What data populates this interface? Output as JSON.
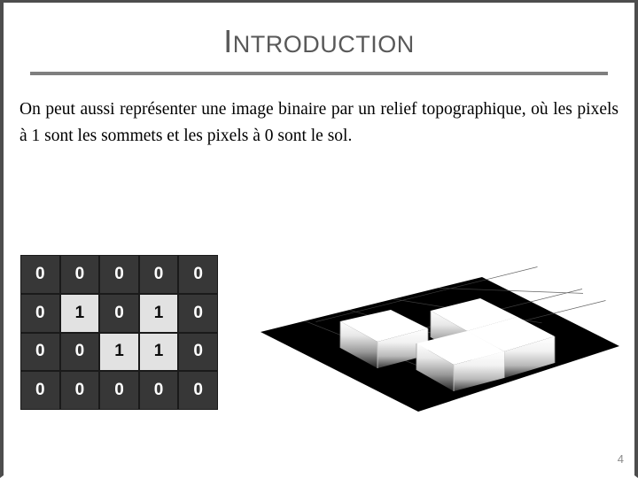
{
  "slide": {
    "title_initial": "I",
    "title_rest": "NTRODUCTION",
    "page_number": "4",
    "accent_color": "#595959",
    "rule_color": "#7f7f7f",
    "frame_color": "#4d4d4d"
  },
  "body": {
    "paragraph": "On peut aussi représenter une image binaire par un relief topographique, où les pixels à 1 sont les sommets et les pixels à 0 sont le sol."
  },
  "matrix": {
    "rows": 4,
    "cols": 5,
    "zero_bg": "#373737",
    "zero_fg": "#ffffff",
    "one_bg": "#e2e2e2",
    "one_fg": "#0d0d0d",
    "values": [
      [
        "0",
        "0",
        "0",
        "0",
        "0"
      ],
      [
        "0",
        "1",
        "0",
        "1",
        "0"
      ],
      [
        "0",
        "0",
        "1",
        "1",
        "0"
      ],
      [
        "0",
        "0",
        "0",
        "0",
        "0"
      ]
    ]
  },
  "relief": {
    "caption": "",
    "ground_color": "#000000",
    "grid_line_color": "#555555",
    "block_top_color": "#ffffff",
    "block_count": "4",
    "raised_cells": [
      {
        "row": "1",
        "col": "1"
      },
      {
        "row": "1",
        "col": "3"
      },
      {
        "row": "2",
        "col": "2"
      },
      {
        "row": "2",
        "col": "3"
      }
    ]
  }
}
